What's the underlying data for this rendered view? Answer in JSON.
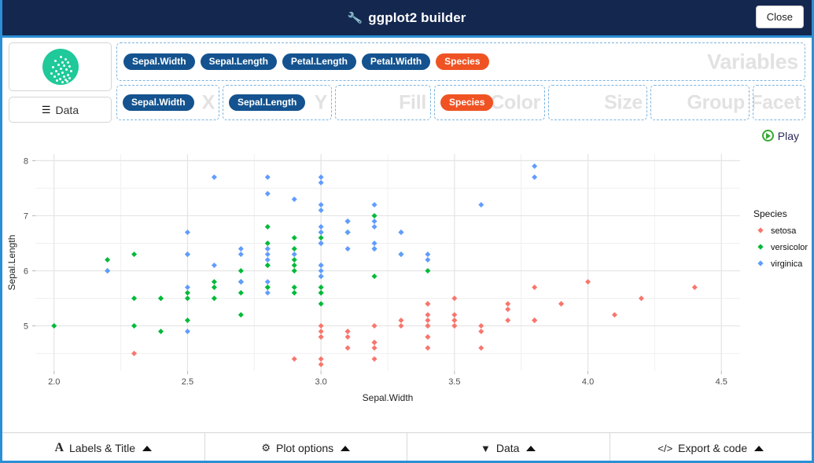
{
  "window": {
    "title": "ggplot2 builder",
    "title_icon": "wrench-icon",
    "close_label": "Close"
  },
  "left_panel": {
    "geom_icon": "scatter-plot-icon",
    "data_button_label": "Data",
    "data_button_icon": "database-icon"
  },
  "variables": {
    "zone_label": "Variables",
    "items": [
      {
        "label": "Sepal.Width",
        "color": "blue"
      },
      {
        "label": "Sepal.Length",
        "color": "blue"
      },
      {
        "label": "Petal.Length",
        "color": "blue"
      },
      {
        "label": "Petal.Width",
        "color": "blue"
      },
      {
        "label": "Species",
        "color": "orange"
      }
    ]
  },
  "aesthetics": [
    {
      "zone": "X",
      "label": "X",
      "pill": "Sepal.Width",
      "pill_color": "blue"
    },
    {
      "zone": "Y",
      "label": "Y",
      "pill": "Sepal.Length",
      "pill_color": "blue"
    },
    {
      "zone": "Fill",
      "label": "Fill",
      "pill": "",
      "pill_color": ""
    },
    {
      "zone": "Color",
      "label": "Color",
      "pill": "Species",
      "pill_color": "orange"
    },
    {
      "zone": "Size",
      "label": "Size",
      "pill": "",
      "pill_color": ""
    },
    {
      "zone": "Group",
      "label": "Group",
      "pill": "",
      "pill_color": ""
    },
    {
      "zone": "Facet",
      "label": "Facet",
      "pill": "",
      "pill_color": ""
    }
  ],
  "play": {
    "label": "Play",
    "icon": "play-circle-icon"
  },
  "bottom_bar": [
    {
      "label": "Labels & Title",
      "icon": "font-letter-icon",
      "caret": "caret-up-icon"
    },
    {
      "label": "Plot options",
      "icon": "gears-icon",
      "caret": "caret-up-icon"
    },
    {
      "label": "Data",
      "icon": "filter-icon",
      "caret": "caret-up-icon"
    },
    {
      "label": "Export & code",
      "icon": "code-brackets-icon",
      "caret": "caret-up-icon"
    }
  ],
  "colors": {
    "title_bar": "#13274f",
    "accent": "#2b8fd6",
    "pill_blue": "#14538f",
    "pill_orange": "#f05323",
    "geom_icon": "#1fc99a",
    "setosa": "#f8766d",
    "versicolor": "#00ba38",
    "virginica": "#619cff"
  },
  "chart_data": {
    "type": "scatter",
    "title": "",
    "xlabel": "Sepal.Width",
    "ylabel": "Sepal.Length",
    "xlim": [
      1.93,
      4.57
    ],
    "ylim": [
      4.18,
      8.12
    ],
    "xticks": [
      "2.0",
      "2.5",
      "3.0",
      "3.5",
      "4.0",
      "4.5"
    ],
    "xtick_values": [
      2.0,
      2.5,
      3.0,
      3.5,
      4.0,
      4.5
    ],
    "yticks": [
      "5",
      "6",
      "7",
      "8"
    ],
    "ytick_values": [
      5,
      6,
      7,
      8
    ],
    "grid": true,
    "legend_position": "right",
    "legend_title": "Species",
    "marker": "diamond",
    "series": [
      {
        "name": "setosa",
        "color": "#f8766d",
        "points": [
          [
            3.5,
            5.1
          ],
          [
            3.0,
            4.9
          ],
          [
            3.2,
            4.7
          ],
          [
            3.1,
            4.6
          ],
          [
            3.6,
            5.0
          ],
          [
            3.9,
            5.4
          ],
          [
            3.4,
            4.6
          ],
          [
            3.4,
            5.0
          ],
          [
            2.9,
            4.4
          ],
          [
            3.1,
            4.9
          ],
          [
            3.7,
            5.4
          ],
          [
            3.4,
            4.8
          ],
          [
            3.0,
            4.8
          ],
          [
            3.0,
            4.3
          ],
          [
            4.0,
            5.8
          ],
          [
            4.4,
            5.7
          ],
          [
            3.9,
            5.4
          ],
          [
            3.5,
            5.1
          ],
          [
            3.8,
            5.7
          ],
          [
            3.8,
            5.1
          ],
          [
            3.4,
            5.4
          ],
          [
            3.7,
            5.1
          ],
          [
            3.6,
            4.6
          ],
          [
            3.3,
            5.1
          ],
          [
            3.4,
            4.8
          ],
          [
            3.0,
            5.0
          ],
          [
            3.4,
            5.0
          ],
          [
            3.5,
            5.2
          ],
          [
            3.4,
            5.2
          ],
          [
            3.2,
            4.7
          ],
          [
            3.1,
            4.8
          ],
          [
            3.4,
            5.4
          ],
          [
            4.1,
            5.2
          ],
          [
            4.2,
            5.5
          ],
          [
            3.1,
            4.9
          ],
          [
            3.2,
            5.0
          ],
          [
            3.5,
            5.5
          ],
          [
            3.6,
            4.9
          ],
          [
            3.0,
            4.4
          ],
          [
            3.4,
            5.1
          ],
          [
            3.5,
            5.0
          ],
          [
            2.3,
            4.5
          ],
          [
            3.2,
            4.4
          ],
          [
            3.5,
            5.0
          ],
          [
            3.8,
            5.1
          ],
          [
            3.0,
            4.8
          ],
          [
            3.8,
            5.1
          ],
          [
            3.2,
            4.6
          ],
          [
            3.7,
            5.3
          ],
          [
            3.3,
            5.0
          ]
        ]
      },
      {
        "name": "versicolor",
        "color": "#00ba38",
        "points": [
          [
            3.2,
            7.0
          ],
          [
            3.2,
            6.4
          ],
          [
            3.1,
            6.9
          ],
          [
            2.3,
            5.5
          ],
          [
            2.8,
            6.5
          ],
          [
            2.8,
            5.7
          ],
          [
            3.3,
            6.3
          ],
          [
            2.4,
            4.9
          ],
          [
            2.9,
            6.6
          ],
          [
            2.7,
            5.2
          ],
          [
            2.0,
            5.0
          ],
          [
            3.0,
            5.9
          ],
          [
            2.2,
            6.0
          ],
          [
            2.9,
            6.1
          ],
          [
            2.9,
            5.6
          ],
          [
            3.1,
            6.7
          ],
          [
            3.0,
            5.6
          ],
          [
            2.7,
            5.8
          ],
          [
            2.2,
            6.2
          ],
          [
            2.5,
            5.6
          ],
          [
            3.2,
            5.9
          ],
          [
            2.8,
            6.1
          ],
          [
            2.5,
            6.3
          ],
          [
            2.8,
            6.1
          ],
          [
            2.9,
            6.4
          ],
          [
            3.0,
            6.6
          ],
          [
            2.8,
            6.8
          ],
          [
            3.0,
            6.7
          ],
          [
            2.9,
            6.0
          ],
          [
            2.6,
            5.7
          ],
          [
            2.4,
            5.5
          ],
          [
            2.4,
            5.5
          ],
          [
            2.7,
            5.8
          ],
          [
            2.7,
            6.0
          ],
          [
            3.0,
            5.4
          ],
          [
            3.4,
            6.0
          ],
          [
            3.1,
            6.7
          ],
          [
            2.3,
            6.3
          ],
          [
            3.0,
            5.6
          ],
          [
            2.5,
            5.5
          ],
          [
            2.6,
            5.5
          ],
          [
            3.0,
            6.1
          ],
          [
            2.6,
            5.8
          ],
          [
            2.3,
            5.0
          ],
          [
            2.7,
            5.6
          ],
          [
            3.0,
            5.7
          ],
          [
            2.9,
            5.7
          ],
          [
            2.9,
            6.2
          ],
          [
            2.5,
            5.1
          ],
          [
            2.8,
            5.7
          ]
        ]
      },
      {
        "name": "virginica",
        "color": "#619cff",
        "points": [
          [
            3.3,
            6.3
          ],
          [
            2.7,
            5.8
          ],
          [
            3.0,
            7.1
          ],
          [
            2.9,
            6.3
          ],
          [
            3.0,
            6.5
          ],
          [
            3.0,
            7.6
          ],
          [
            2.5,
            4.9
          ],
          [
            2.9,
            7.3
          ],
          [
            2.5,
            6.7
          ],
          [
            3.6,
            7.2
          ],
          [
            3.2,
            6.5
          ],
          [
            2.7,
            6.4
          ],
          [
            3.0,
            6.8
          ],
          [
            2.5,
            5.7
          ],
          [
            2.8,
            5.8
          ],
          [
            3.2,
            6.4
          ],
          [
            3.0,
            6.5
          ],
          [
            3.8,
            7.7
          ],
          [
            2.6,
            7.7
          ],
          [
            2.2,
            6.0
          ],
          [
            3.2,
            6.9
          ],
          [
            2.8,
            5.6
          ],
          [
            2.8,
            7.7
          ],
          [
            2.7,
            6.3
          ],
          [
            3.3,
            6.7
          ],
          [
            3.2,
            7.2
          ],
          [
            2.8,
            6.2
          ],
          [
            3.0,
            6.1
          ],
          [
            2.8,
            6.4
          ],
          [
            3.0,
            7.2
          ],
          [
            2.8,
            7.4
          ],
          [
            3.8,
            7.9
          ],
          [
            2.8,
            6.4
          ],
          [
            2.8,
            6.3
          ],
          [
            2.6,
            6.1
          ],
          [
            3.0,
            7.7
          ],
          [
            3.4,
            6.3
          ],
          [
            3.1,
            6.4
          ],
          [
            3.0,
            6.0
          ],
          [
            3.1,
            6.9
          ],
          [
            3.1,
            6.7
          ],
          [
            3.1,
            6.9
          ],
          [
            2.7,
            5.8
          ],
          [
            3.2,
            6.8
          ],
          [
            3.3,
            6.7
          ],
          [
            3.0,
            6.7
          ],
          [
            2.5,
            6.3
          ],
          [
            3.0,
            6.5
          ],
          [
            3.4,
            6.2
          ],
          [
            3.0,
            5.9
          ]
        ]
      }
    ]
  }
}
